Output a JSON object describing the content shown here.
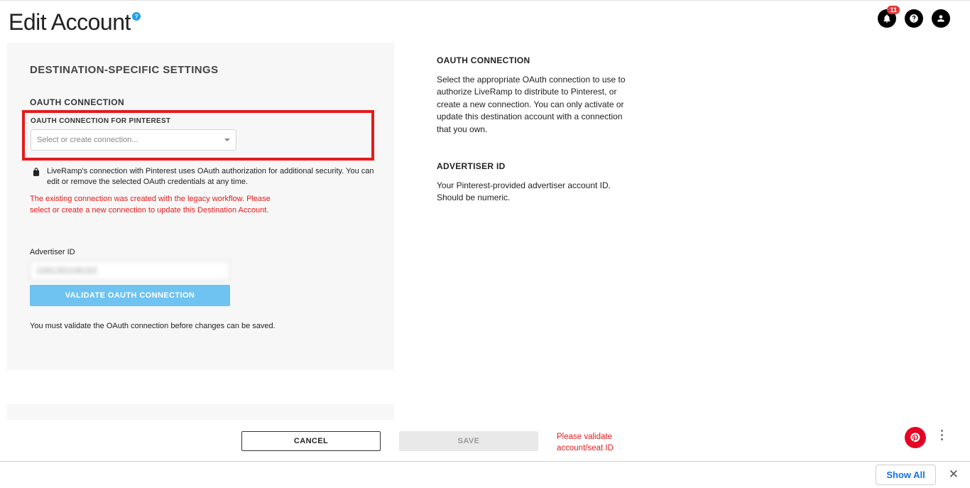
{
  "header": {
    "title": "Edit Account",
    "notif_count": "11"
  },
  "left": {
    "panel_heading": "DESTINATION-SPECIFIC SETTINGS",
    "oauth_section_label": "OAUTH CONNECTION",
    "oauth_caption": "OAUTH CONNECTION FOR PINTEREST",
    "oauth_placeholder": "Select or create connection...",
    "lock_text": "LiveRamp's connection with Pinterest uses OAuth authorization for additional security. You can edit or remove the selected OAuth credentials at any time.",
    "warning_text": "The existing connection was created with the legacy workflow. Please select or create a new connection to update this Destination Account.",
    "advertiser_label": "Advertiser ID",
    "advertiser_value": "1091281106162",
    "validate_button": "VALIDATE OAUTH CONNECTION",
    "note": "You must validate the OAuth connection before changes can be saved."
  },
  "right": {
    "sec1_heading": "OAUTH CONNECTION",
    "sec1_body": "Select the appropriate OAuth connection to use to authorize LiveRamp to distribute to Pinterest, or create a new connection. You can only activate or update this destination account with a connection that you own.",
    "sec2_heading": "ADVERTISER ID",
    "sec2_body": "Your Pinterest-provided advertiser account ID. Should be numeric."
  },
  "footer": {
    "cancel": "CANCEL",
    "save": "SAVE",
    "warn": "Please validate account/seat ID"
  },
  "bottombar": {
    "show_all": "Show All"
  }
}
